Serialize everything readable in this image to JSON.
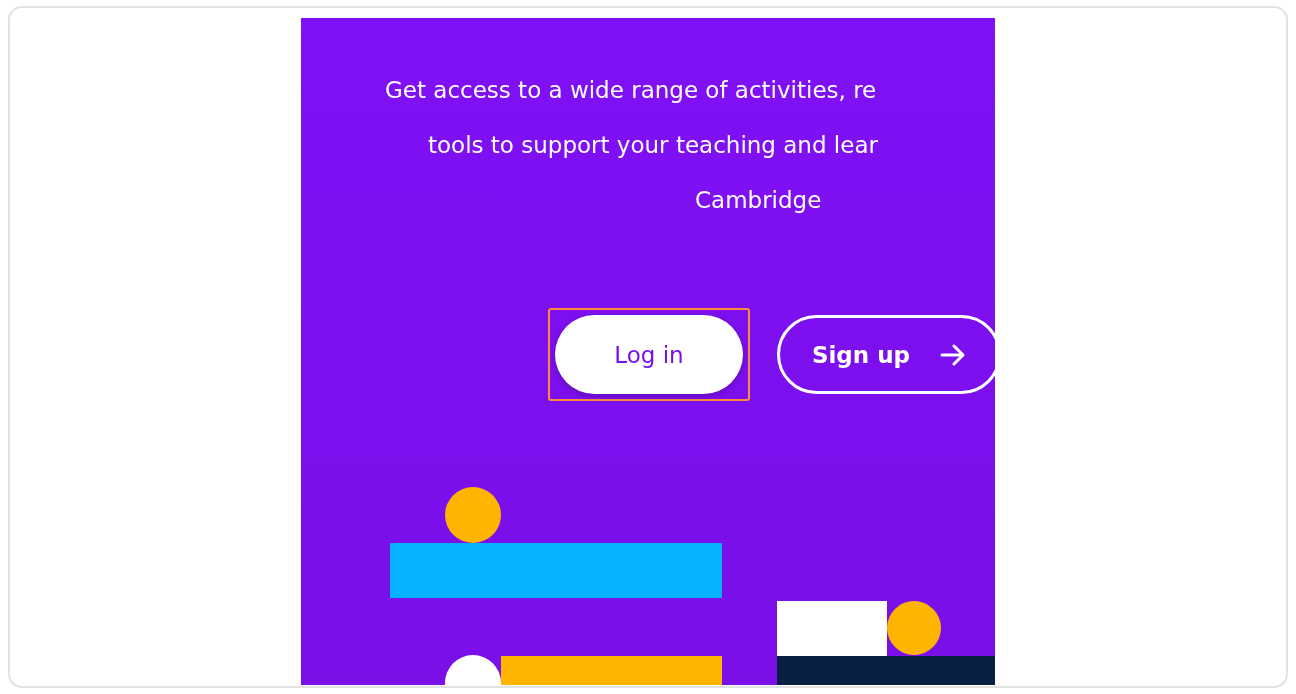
{
  "intro_lines": [
    "Get access to a wide range of activities, re",
    "tools to support your teaching and lear",
    "Cambridge"
  ],
  "buttons": [
    {
      "kind": "filled",
      "label": "Log in",
      "highlighted": true
    },
    {
      "kind": "outline",
      "label": "Sign up",
      "highlighted": false
    }
  ]
}
